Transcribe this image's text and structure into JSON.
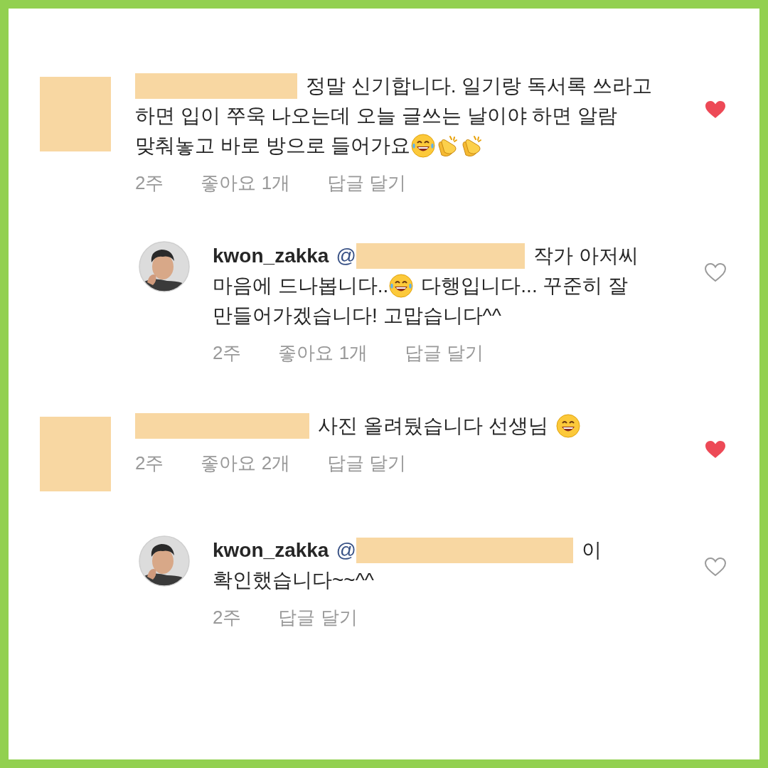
{
  "comments": [
    {
      "liked": true,
      "lines": [
        [
          {
            "kind": "redaction"
          },
          {
            "kind": "text",
            "text": "정말 신기합니다. 일기랑 독서록 쓰라고"
          }
        ],
        [
          {
            "kind": "text",
            "text": "하면 입이 쭈욱 나오는데 오늘 글쓰는 날이야 하면 알람"
          }
        ],
        [
          {
            "kind": "text",
            "text": "맞춰놓고 바로 방으로 들어가요"
          },
          {
            "kind": "laugh"
          },
          {
            "kind": "clap"
          },
          {
            "kind": "clap"
          }
        ]
      ],
      "meta": {
        "time": "2주",
        "likes": "좋아요 1개",
        "reply": "답글 달기"
      },
      "replies": [
        {
          "liked": false,
          "lines": [
            [
              {
                "kind": "username",
                "text": "kwon_zakka"
              },
              {
                "kind": "mention",
                "text": "@"
              },
              {
                "kind": "redaction"
              },
              {
                "kind": "text",
                "text": "작가 아저씨"
              }
            ],
            [
              {
                "kind": "text",
                "text": "마음에 드나봅니다.."
              },
              {
                "kind": "laugh"
              },
              {
                "kind": "text",
                "text": "다행입니다... 꾸준히 잘"
              }
            ],
            [
              {
                "kind": "text",
                "text": "만들어가겠습니다! 고맙습니다^^"
              }
            ]
          ],
          "meta": {
            "time": "2주",
            "likes": "좋아요 1개",
            "reply": "답글 달기"
          }
        }
      ]
    },
    {
      "liked": true,
      "lines": [
        [
          {
            "kind": "redaction"
          },
          {
            "kind": "text",
            "text": "사진 올려뒀습니다 선생님"
          },
          {
            "kind": "grin"
          }
        ]
      ],
      "meta": {
        "time": "2주",
        "likes": "좋아요 2개",
        "reply": "답글 달기"
      },
      "replies": [
        {
          "liked": false,
          "lines": [
            [
              {
                "kind": "username",
                "text": "kwon_zakka"
              },
              {
                "kind": "mention",
                "text": "@"
              },
              {
                "kind": "redaction"
              },
              {
                "kind": "text",
                "text": "이"
              }
            ],
            [
              {
                "kind": "text",
                "text": "확인했습니다~~^^"
              }
            ]
          ],
          "meta": {
            "time": "2주",
            "reply": "답글 달기"
          }
        }
      ]
    }
  ]
}
